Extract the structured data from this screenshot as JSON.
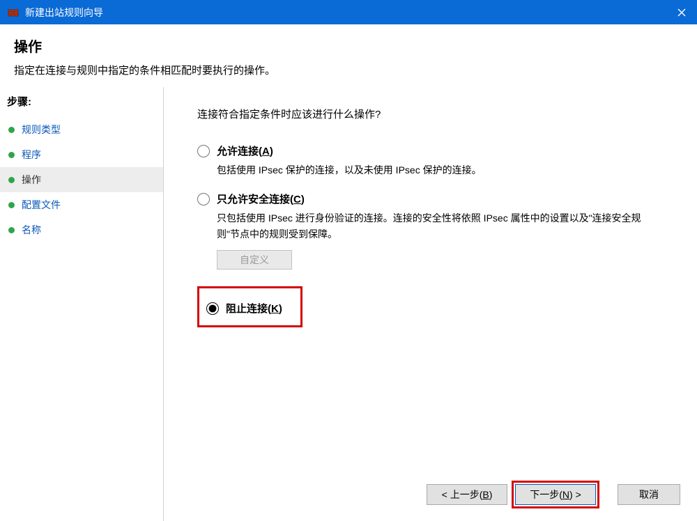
{
  "window": {
    "title": "新建出站规则向导"
  },
  "header": {
    "title": "操作",
    "subtitle": "指定在连接与规则中指定的条件相匹配时要执行的操作。"
  },
  "sidebar": {
    "steps_label": "步骤:",
    "items": [
      {
        "label": "规则类型",
        "active": false
      },
      {
        "label": "程序",
        "active": false
      },
      {
        "label": "操作",
        "active": true
      },
      {
        "label": "配置文件",
        "active": false
      },
      {
        "label": "名称",
        "active": false
      }
    ]
  },
  "main": {
    "question": "连接符合指定条件时应该进行什么操作?",
    "options": {
      "allow": {
        "label_prefix": "允许连接(",
        "access_key": "A",
        "label_suffix": ")",
        "description": "包括使用 IPsec 保护的连接，以及未使用 IPsec 保护的连接。",
        "checked": false
      },
      "secure": {
        "label_prefix": "只允许安全连接(",
        "access_key": "C",
        "label_suffix": ")",
        "description": "只包括使用 IPsec 进行身份验证的连接。连接的安全性将依照 IPsec 属性中的设置以及\"连接安全规则\"节点中的规则受到保障。",
        "checked": false,
        "customize_label": "自定义"
      },
      "block": {
        "label_prefix": "阻止连接(",
        "access_key": "K",
        "label_suffix": ")",
        "checked": true
      }
    }
  },
  "footer": {
    "back_prefix": "< 上一步(",
    "back_access": "B",
    "back_suffix": ")",
    "next_prefix": "下一步(",
    "next_access": "N",
    "next_suffix": ") >",
    "cancel": "取消"
  }
}
